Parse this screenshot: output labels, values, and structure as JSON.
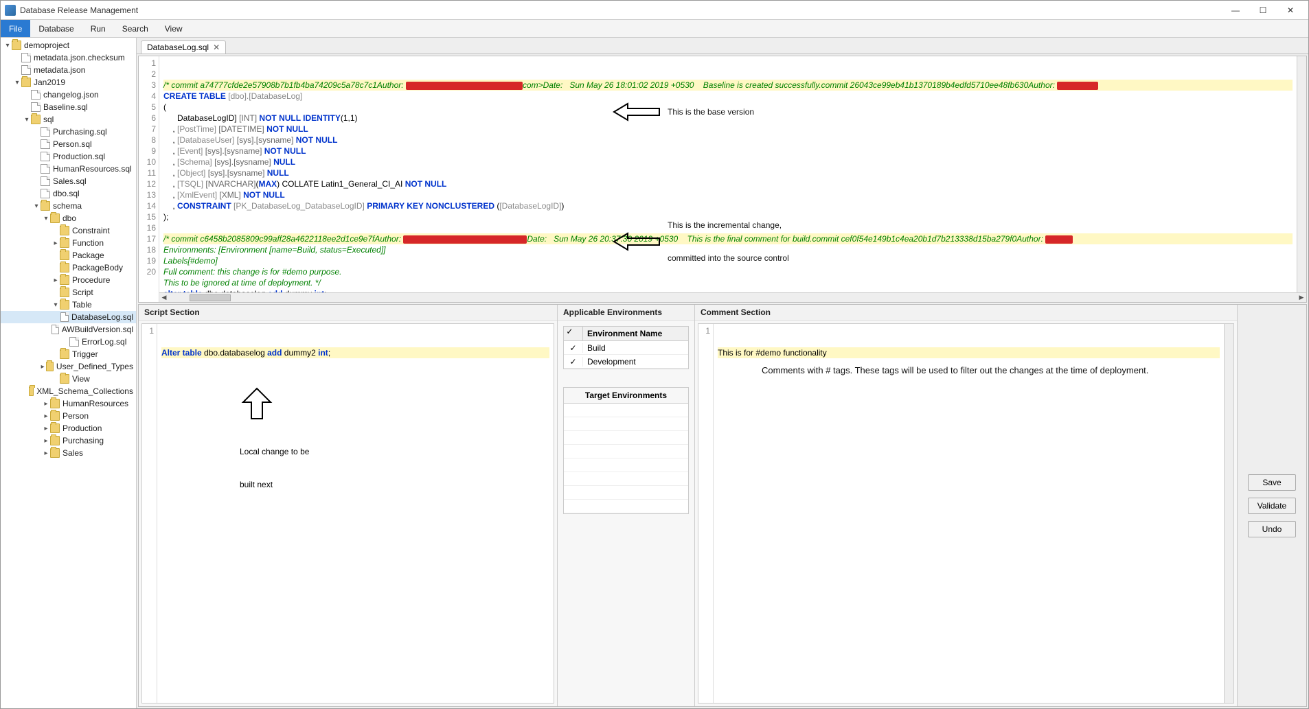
{
  "window": {
    "title": "Database Release Management"
  },
  "menu": {
    "file": "File",
    "database": "Database",
    "run": "Run",
    "search": "Search",
    "view": "View"
  },
  "tree": [
    {
      "d": 0,
      "tw": "▾",
      "ic": "folder",
      "label": "demoproject"
    },
    {
      "d": 1,
      "tw": "",
      "ic": "file",
      "label": "metadata.json.checksum"
    },
    {
      "d": 1,
      "tw": "",
      "ic": "file",
      "label": "metadata.json"
    },
    {
      "d": 1,
      "tw": "▾",
      "ic": "folder",
      "label": "Jan2019"
    },
    {
      "d": 2,
      "tw": "",
      "ic": "file",
      "label": "changelog.json"
    },
    {
      "d": 2,
      "tw": "",
      "ic": "file",
      "label": "Baseline.sql"
    },
    {
      "d": 2,
      "tw": "▾",
      "ic": "folder",
      "label": "sql"
    },
    {
      "d": 3,
      "tw": "",
      "ic": "file",
      "label": "Purchasing.sql"
    },
    {
      "d": 3,
      "tw": "",
      "ic": "file",
      "label": "Person.sql"
    },
    {
      "d": 3,
      "tw": "",
      "ic": "file",
      "label": "Production.sql"
    },
    {
      "d": 3,
      "tw": "",
      "ic": "file",
      "label": "HumanResources.sql"
    },
    {
      "d": 3,
      "tw": "",
      "ic": "file",
      "label": "Sales.sql"
    },
    {
      "d": 3,
      "tw": "",
      "ic": "file",
      "label": "dbo.sql"
    },
    {
      "d": 3,
      "tw": "▾",
      "ic": "folder",
      "label": "schema"
    },
    {
      "d": 4,
      "tw": "▾",
      "ic": "folder",
      "label": "dbo"
    },
    {
      "d": 5,
      "tw": "",
      "ic": "folder",
      "label": "Constraint"
    },
    {
      "d": 5,
      "tw": "▸",
      "ic": "folder",
      "label": "Function"
    },
    {
      "d": 5,
      "tw": "",
      "ic": "folder",
      "label": "Package"
    },
    {
      "d": 5,
      "tw": "",
      "ic": "folder",
      "label": "PackageBody"
    },
    {
      "d": 5,
      "tw": "▸",
      "ic": "folder",
      "label": "Procedure"
    },
    {
      "d": 5,
      "tw": "",
      "ic": "folder",
      "label": "Script"
    },
    {
      "d": 5,
      "tw": "▾",
      "ic": "folder",
      "label": "Table"
    },
    {
      "d": 6,
      "tw": "",
      "ic": "file",
      "label": "DatabaseLog.sql",
      "selected": true
    },
    {
      "d": 6,
      "tw": "",
      "ic": "file",
      "label": "AWBuildVersion.sql"
    },
    {
      "d": 6,
      "tw": "",
      "ic": "file",
      "label": "ErrorLog.sql"
    },
    {
      "d": 5,
      "tw": "",
      "ic": "folder",
      "label": "Trigger"
    },
    {
      "d": 5,
      "tw": "▸",
      "ic": "folder",
      "label": "User_Defined_Types"
    },
    {
      "d": 5,
      "tw": "",
      "ic": "folder",
      "label": "View"
    },
    {
      "d": 5,
      "tw": "",
      "ic": "folder",
      "label": "XML_Schema_Collections"
    },
    {
      "d": 4,
      "tw": "▸",
      "ic": "folder",
      "label": "HumanResources"
    },
    {
      "d": 4,
      "tw": "▸",
      "ic": "folder",
      "label": "Person"
    },
    {
      "d": 4,
      "tw": "▸",
      "ic": "folder",
      "label": "Production"
    },
    {
      "d": 4,
      "tw": "▸",
      "ic": "folder",
      "label": "Purchasing"
    },
    {
      "d": 4,
      "tw": "▸",
      "ic": "folder",
      "label": "Sales"
    }
  ],
  "tab": {
    "label": "DatabaseLog.sql"
  },
  "editor": {
    "lines": [
      {
        "n": 1,
        "hl": true,
        "html": "<span class='c-comment'>/* commit a74777cfde2e57908b7b1fb4ba74209c5a78c7c1Author: </span><span class='redbox' style='width:170px'></span><span class='c-comment'>com&gt;Date:   Sun May 26 18:01:02 2019 +0530    Baseline is created successfully.commit 26043ce99eb41b1370189b4edfd5710ee48fb630Author: </span><span class='redbox' style='width:60px'></span>"
      },
      {
        "n": 2,
        "html": "<span class='c-key'>CREATE TABLE</span> <span class='c-id'>[dbo].[DatabaseLog]</span>"
      },
      {
        "n": 3,
        "html": "("
      },
      {
        "n": 4,
        "html": "      DatabaseLogID] <span class='c-type'>[INT]</span> <span class='c-key'>NOT NULL IDENTITY</span>(1,1)"
      },
      {
        "n": 5,
        "html": "    , <span class='c-id'>[PostTime]</span> <span class='c-type'>[DATETIME]</span> <span class='c-key'>NOT NULL</span>"
      },
      {
        "n": 6,
        "html": "    , <span class='c-id'>[DatabaseUser]</span> <span class='c-type'>[sys].[sysname]</span> <span class='c-key'>NOT NULL</span>"
      },
      {
        "n": 7,
        "html": "    , <span class='c-id'>[Event]</span> <span class='c-type'>[sys].[sysname]</span> <span class='c-key'>NOT NULL</span>"
      },
      {
        "n": 8,
        "html": "    , <span class='c-id'>[Schema]</span> <span class='c-type'>[sys].[sysname]</span> <span class='c-key'>NULL</span>"
      },
      {
        "n": 9,
        "html": "    , <span class='c-id'>[Object]</span> <span class='c-type'>[sys].[sysname]</span> <span class='c-key'>NULL</span>"
      },
      {
        "n": 10,
        "html": "    , <span class='c-id'>[TSQL]</span> <span class='c-type'>[NVARCHAR]</span>(<span class='c-key'>MAX</span>) COLLATE Latin1_General_CI_AI <span class='c-key'>NOT NULL</span>"
      },
      {
        "n": 11,
        "html": "    , <span class='c-id'>[XmlEvent]</span> <span class='c-type'>[XML]</span> <span class='c-key'>NOT NULL</span>"
      },
      {
        "n": 12,
        "html": "    , <span class='c-key'>CONSTRAINT</span> <span class='c-id'>[PK_DatabaseLog_DatabaseLogID]</span> <span class='c-key'>PRIMARY KEY NONCLUSTERED</span> (<span class='c-id'>[DatabaseLogID]</span>)"
      },
      {
        "n": 13,
        "html": ");"
      },
      {
        "n": 14,
        "html": " "
      },
      {
        "n": 15,
        "hl": true,
        "html": "<span class='c-comment'>/* commit c6458b2085809c99aff28a4622118ee2d1ce9e7fAuthor: </span><span class='redbox' style='width:180px'></span><span class='c-comment'>Date:   Sun May 26 20:37:30 2019 +0530    This is the final comment for build.commit cef0f54e149b1c4ea20b1d7b213338d15ba279f0Author: </span><span class='redbox' style='width:40px'></span>"
      },
      {
        "n": 16,
        "html": "<span class='c-comment'>Environments: [Environment [name=Build, status=Executed]]</span>"
      },
      {
        "n": 17,
        "html": "<span class='c-comment'>Labels[#demo]</span>"
      },
      {
        "n": 18,
        "html": "<span class='c-comment'>Full comment: this change is for #demo purpose.</span>"
      },
      {
        "n": 19,
        "html": "<span class='c-comment'>This to be ignored at time of deployment. */</span>"
      },
      {
        "n": 20,
        "html": "<span class='c-key'>alter table</span> dbo.databaselog <span class='c-key'>add</span> dummy <span class='c-key'>int</span>;"
      }
    ],
    "annot1": "This is the base version",
    "annot2a": "This is the incremental change,",
    "annot2b": "committed into the source control"
  },
  "panels": {
    "script_title": "Script Section",
    "env_title": "Applicable Environments",
    "comment_title": "Comment Section",
    "script_line": "Alter table dbo.databaselog add dummy2 int;",
    "script_annot1": "Local change to be",
    "script_annot2": "built next",
    "env_header": "Environment Name",
    "env_rows": [
      {
        "checked": true,
        "name": "Build"
      },
      {
        "checked": true,
        "name": "Development"
      }
    ],
    "target_header": "Target Environments",
    "comment_line": "This is for #demo functionality",
    "comment_annot": "Comments with # tags. These tags will be used to filter out the changes at the time of deployment."
  },
  "buttons": {
    "save": "Save",
    "validate": "Validate",
    "undo": "Undo"
  }
}
